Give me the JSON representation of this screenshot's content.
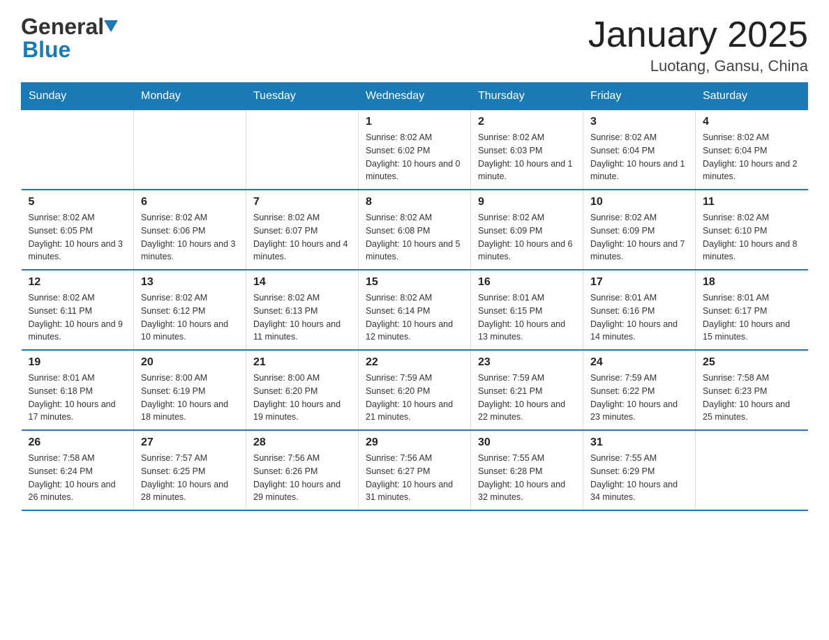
{
  "header": {
    "logo_general": "General",
    "logo_blue": "Blue",
    "month_title": "January 2025",
    "location": "Luotang, Gansu, China"
  },
  "days_of_week": [
    "Sunday",
    "Monday",
    "Tuesday",
    "Wednesday",
    "Thursday",
    "Friday",
    "Saturday"
  ],
  "weeks": [
    [
      {
        "day": "",
        "info": ""
      },
      {
        "day": "",
        "info": ""
      },
      {
        "day": "",
        "info": ""
      },
      {
        "day": "1",
        "info": "Sunrise: 8:02 AM\nSunset: 6:02 PM\nDaylight: 10 hours\nand 0 minutes."
      },
      {
        "day": "2",
        "info": "Sunrise: 8:02 AM\nSunset: 6:03 PM\nDaylight: 10 hours\nand 1 minute."
      },
      {
        "day": "3",
        "info": "Sunrise: 8:02 AM\nSunset: 6:04 PM\nDaylight: 10 hours\nand 1 minute."
      },
      {
        "day": "4",
        "info": "Sunrise: 8:02 AM\nSunset: 6:04 PM\nDaylight: 10 hours\nand 2 minutes."
      }
    ],
    [
      {
        "day": "5",
        "info": "Sunrise: 8:02 AM\nSunset: 6:05 PM\nDaylight: 10 hours\nand 3 minutes."
      },
      {
        "day": "6",
        "info": "Sunrise: 8:02 AM\nSunset: 6:06 PM\nDaylight: 10 hours\nand 3 minutes."
      },
      {
        "day": "7",
        "info": "Sunrise: 8:02 AM\nSunset: 6:07 PM\nDaylight: 10 hours\nand 4 minutes."
      },
      {
        "day": "8",
        "info": "Sunrise: 8:02 AM\nSunset: 6:08 PM\nDaylight: 10 hours\nand 5 minutes."
      },
      {
        "day": "9",
        "info": "Sunrise: 8:02 AM\nSunset: 6:09 PM\nDaylight: 10 hours\nand 6 minutes."
      },
      {
        "day": "10",
        "info": "Sunrise: 8:02 AM\nSunset: 6:09 PM\nDaylight: 10 hours\nand 7 minutes."
      },
      {
        "day": "11",
        "info": "Sunrise: 8:02 AM\nSunset: 6:10 PM\nDaylight: 10 hours\nand 8 minutes."
      }
    ],
    [
      {
        "day": "12",
        "info": "Sunrise: 8:02 AM\nSunset: 6:11 PM\nDaylight: 10 hours\nand 9 minutes."
      },
      {
        "day": "13",
        "info": "Sunrise: 8:02 AM\nSunset: 6:12 PM\nDaylight: 10 hours\nand 10 minutes."
      },
      {
        "day": "14",
        "info": "Sunrise: 8:02 AM\nSunset: 6:13 PM\nDaylight: 10 hours\nand 11 minutes."
      },
      {
        "day": "15",
        "info": "Sunrise: 8:02 AM\nSunset: 6:14 PM\nDaylight: 10 hours\nand 12 minutes."
      },
      {
        "day": "16",
        "info": "Sunrise: 8:01 AM\nSunset: 6:15 PM\nDaylight: 10 hours\nand 13 minutes."
      },
      {
        "day": "17",
        "info": "Sunrise: 8:01 AM\nSunset: 6:16 PM\nDaylight: 10 hours\nand 14 minutes."
      },
      {
        "day": "18",
        "info": "Sunrise: 8:01 AM\nSunset: 6:17 PM\nDaylight: 10 hours\nand 15 minutes."
      }
    ],
    [
      {
        "day": "19",
        "info": "Sunrise: 8:01 AM\nSunset: 6:18 PM\nDaylight: 10 hours\nand 17 minutes."
      },
      {
        "day": "20",
        "info": "Sunrise: 8:00 AM\nSunset: 6:19 PM\nDaylight: 10 hours\nand 18 minutes."
      },
      {
        "day": "21",
        "info": "Sunrise: 8:00 AM\nSunset: 6:20 PM\nDaylight: 10 hours\nand 19 minutes."
      },
      {
        "day": "22",
        "info": "Sunrise: 7:59 AM\nSunset: 6:20 PM\nDaylight: 10 hours\nand 21 minutes."
      },
      {
        "day": "23",
        "info": "Sunrise: 7:59 AM\nSunset: 6:21 PM\nDaylight: 10 hours\nand 22 minutes."
      },
      {
        "day": "24",
        "info": "Sunrise: 7:59 AM\nSunset: 6:22 PM\nDaylight: 10 hours\nand 23 minutes."
      },
      {
        "day": "25",
        "info": "Sunrise: 7:58 AM\nSunset: 6:23 PM\nDaylight: 10 hours\nand 25 minutes."
      }
    ],
    [
      {
        "day": "26",
        "info": "Sunrise: 7:58 AM\nSunset: 6:24 PM\nDaylight: 10 hours\nand 26 minutes."
      },
      {
        "day": "27",
        "info": "Sunrise: 7:57 AM\nSunset: 6:25 PM\nDaylight: 10 hours\nand 28 minutes."
      },
      {
        "day": "28",
        "info": "Sunrise: 7:56 AM\nSunset: 6:26 PM\nDaylight: 10 hours\nand 29 minutes."
      },
      {
        "day": "29",
        "info": "Sunrise: 7:56 AM\nSunset: 6:27 PM\nDaylight: 10 hours\nand 31 minutes."
      },
      {
        "day": "30",
        "info": "Sunrise: 7:55 AM\nSunset: 6:28 PM\nDaylight: 10 hours\nand 32 minutes."
      },
      {
        "day": "31",
        "info": "Sunrise: 7:55 AM\nSunset: 6:29 PM\nDaylight: 10 hours\nand 34 minutes."
      },
      {
        "day": "",
        "info": ""
      }
    ]
  ]
}
